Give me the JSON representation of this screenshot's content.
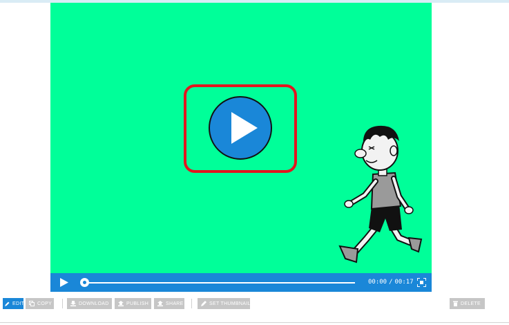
{
  "player": {
    "time_current": "00:00",
    "time_separator": "/",
    "time_total": "00:17",
    "progress": 0,
    "background_color": "#00ff99",
    "controls_color": "#1a87d8",
    "highlight_color": "#e4151f"
  },
  "toolbar": {
    "edit_label": "EDIT",
    "copy_label": "COPY",
    "download_label": "DOWNLOAD",
    "publish_label": "PUBLISH",
    "share_label": "SHARE",
    "set_thumbnail_label": "SET THUMBNAIL",
    "delete_label": "DELETE"
  },
  "icons": {
    "big_play": "play-circle-icon",
    "character": "walking-boy-illustration",
    "control_play": "play-icon",
    "fullscreen": "fullscreen-icon",
    "edit": "pencil-icon",
    "copy": "copy-icon",
    "download": "download-icon",
    "publish": "upload-icon",
    "share": "share-icon",
    "set_thumbnail": "pencil-icon",
    "delete": "trash-icon"
  }
}
